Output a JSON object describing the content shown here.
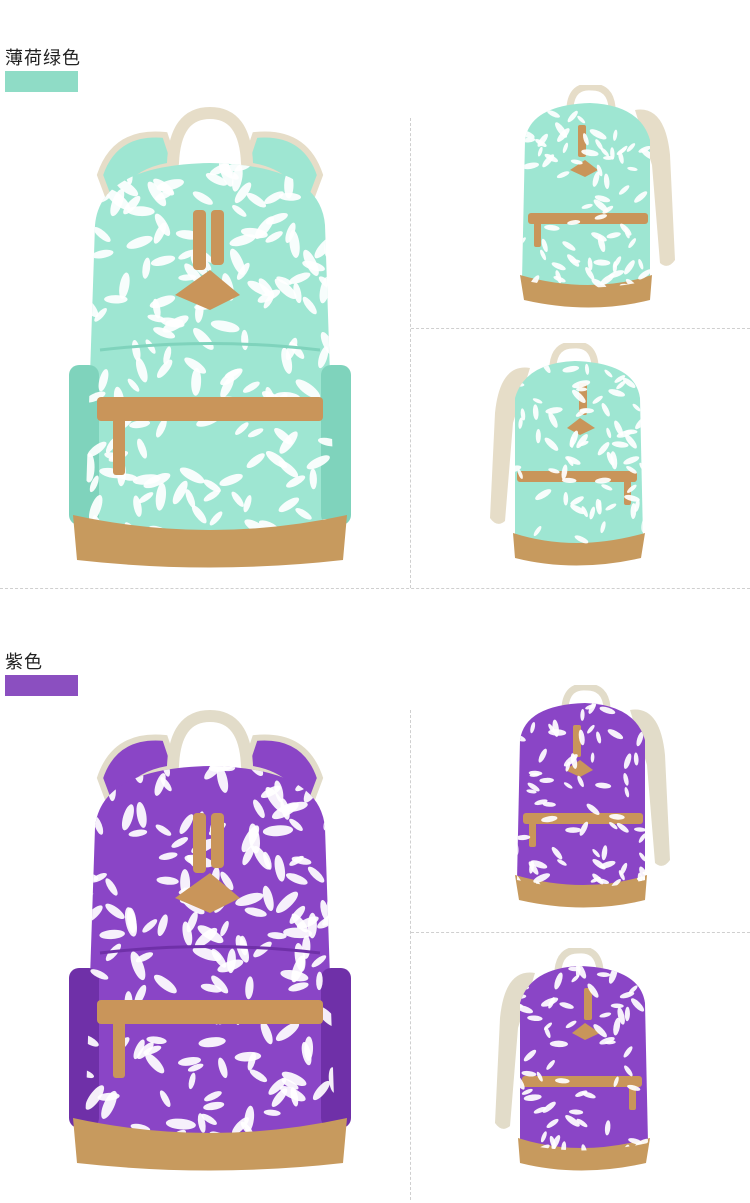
{
  "sections": [
    {
      "label": "薄荷绿色",
      "swatch_color": "#8fdcc6",
      "bag": {
        "body": "#9ee6d2",
        "strap": "#e6ddc8",
        "trim": "#c9955a",
        "bottom": "#c79a5e",
        "pattern": "#ffffff",
        "shade": "#7fd3bc"
      },
      "images": [
        "main-front-view",
        "side-view-right",
        "side-view-left"
      ]
    },
    {
      "label": "紫色",
      "swatch_color": "#8b4fc0",
      "bag": {
        "body": "#8a45c6",
        "strap": "#e2dcc9",
        "trim": "#c9955a",
        "bottom": "#c79a5e",
        "pattern": "#ffffff",
        "shade": "#6f30a8"
      },
      "images": [
        "main-front-view",
        "side-view-right",
        "side-view-left"
      ]
    }
  ]
}
